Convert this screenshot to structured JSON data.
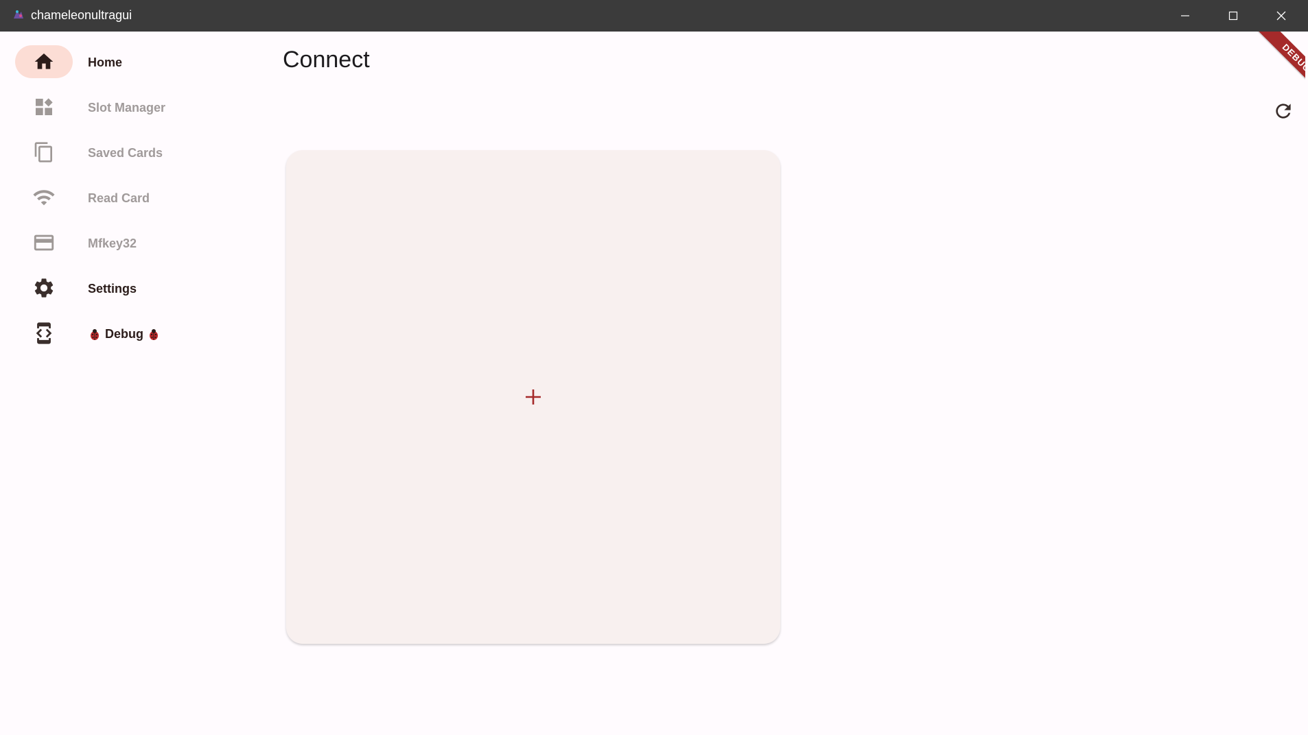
{
  "window": {
    "title": "chameleonultragui"
  },
  "nav": {
    "items": [
      {
        "label": "Home",
        "icon": "home-icon",
        "state": "active"
      },
      {
        "label": "Slot Manager",
        "icon": "dashboard-icon",
        "state": "disabled"
      },
      {
        "label": "Saved Cards",
        "icon": "copy-icon",
        "state": "disabled"
      },
      {
        "label": "Read Card",
        "icon": "wifi-icon",
        "state": "disabled"
      },
      {
        "label": "Mfkey32",
        "icon": "credit-card-icon",
        "state": "disabled"
      },
      {
        "label": "Settings",
        "icon": "gear-icon",
        "state": "enabled"
      },
      {
        "label": "Debug",
        "icon": "developer-mode-icon",
        "state": "enabled",
        "decoration": "ladybug-emoji"
      }
    ]
  },
  "main": {
    "title": "Connect",
    "add_device_icon": "plus-icon",
    "refresh_icon": "refresh-icon"
  },
  "debug_banner": {
    "label": "DEBUG"
  },
  "colors": {
    "accent": "#a52a2a",
    "active_pill": "#fcddd5",
    "card_bg": "#f8f0ef",
    "page_bg": "#fffbfe",
    "titlebar_bg": "#3b3b3b",
    "disabled_text": "#a09a9a"
  }
}
